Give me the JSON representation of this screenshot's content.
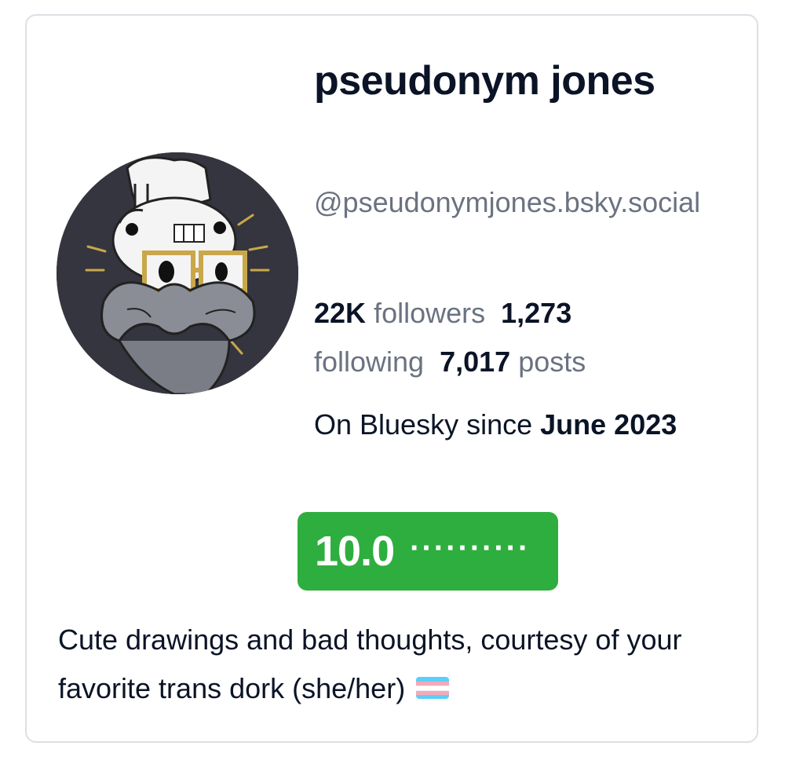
{
  "profile": {
    "display_name": "pseudonym jones",
    "handle": "@pseudonymjones.bsky.social",
    "avatar_icon": "avatar-illustration"
  },
  "stats": {
    "followers_count": "22K",
    "followers_label": "followers",
    "following_count": "1,273",
    "following_label": "following",
    "posts_count": "7,017",
    "posts_label": "posts"
  },
  "joined": {
    "prefix": "On Bluesky since",
    "date": "June 2023"
  },
  "score": {
    "value": "10.0",
    "dots": "··········",
    "color": "#2eae3e"
  },
  "bio": {
    "text": "Cute drawings and bad thoughts, courtesy of your favorite trans dork (she/her)",
    "emoji_icon": "trans-flag-icon"
  },
  "colors": {
    "name_text": "#0b1426",
    "muted_text": "#6b7280",
    "card_border": "#dcdfe5"
  }
}
